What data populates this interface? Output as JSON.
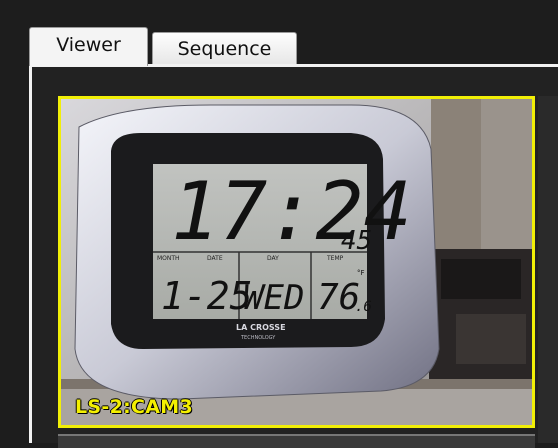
{
  "tabs": [
    {
      "label": "Viewer",
      "active": true
    },
    {
      "label": "Sequence",
      "active": false
    }
  ],
  "camera": {
    "label": "LS-2:CAM3",
    "frame_color": "#f1ef07",
    "clock": {
      "time": "17:24",
      "seconds": "45",
      "date": "1-25",
      "day": "WED",
      "temp": "76",
      "temp_decimal": ".6",
      "temp_unit": "°F",
      "month_caption": "MONTH",
      "date_caption": "DATE",
      "day_caption": "DAY",
      "temp_caption": "TEMP",
      "brand": "LA CROSSE",
      "brand_sub": "TECHNOLOGY"
    }
  }
}
